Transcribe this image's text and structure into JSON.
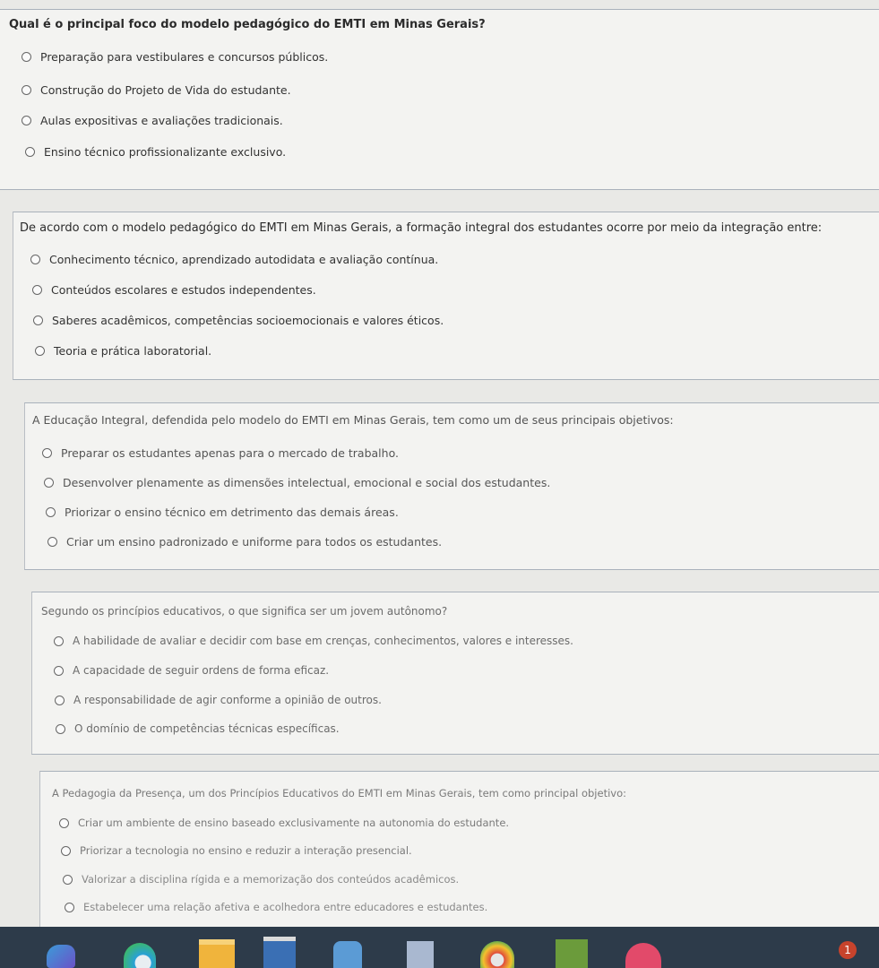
{
  "questions": [
    {
      "text": "Qual é o principal foco do modelo pedagógico do EMTI em Minas Gerais?",
      "options": [
        "Preparação para vestibulares e concursos públicos.",
        "Construção do Projeto de Vida do estudante.",
        "Aulas expositivas e avaliações tradicionais.",
        "Ensino técnico profissionalizante exclusivo."
      ]
    },
    {
      "text": "De acordo com o modelo pedagógico do EMTI em Minas Gerais, a formação integral dos estudantes ocorre por meio da integração entre:",
      "options": [
        "Conhecimento técnico, aprendizado autodidata e avaliação contínua.",
        "Conteúdos escolares e estudos independentes.",
        "Saberes acadêmicos, competências socioemocionais e valores éticos.",
        "Teoria e prática laboratorial."
      ]
    },
    {
      "text": "A Educação Integral, defendida pelo modelo do EMTI em Minas Gerais, tem como um de seus principais objetivos:",
      "options": [
        "Preparar os estudantes apenas para o mercado de trabalho.",
        "Desenvolver plenamente as dimensões intelectual, emocional e social dos estudantes.",
        "Priorizar o ensino técnico em detrimento das demais áreas.",
        "Criar um ensino padronizado e uniforme para todos os estudantes."
      ]
    },
    {
      "text": "Segundo os princípios educativos, o que significa ser um jovem autônomo?",
      "options": [
        "A habilidade de avaliar e decidir com base em crenças, conhecimentos, valores e interesses.",
        "A capacidade de seguir ordens de forma eficaz.",
        "A responsabilidade de agir conforme a opinião de outros.",
        "O domínio de competências técnicas específicas."
      ]
    },
    {
      "text": "A Pedagogia da Presença, um dos Princípios Educativos do EMTI em Minas Gerais, tem como principal objetivo:",
      "options": [
        "Criar um ambiente de ensino baseado exclusivamente na autonomia do estudante.",
        "Priorizar a tecnologia no ensino e reduzir a interação presencial.",
        "Valorizar a disciplina rígida e a memorização dos conteúdos acadêmicos.",
        "Estabelecer uma relação afetiva e acolhedora entre educadores e estudantes."
      ]
    }
  ],
  "taskbar": {
    "icons": [
      "copilot-icon",
      "edge-icon",
      "file-explorer-icon",
      "store-icon",
      "office-icon",
      "word-icon",
      "chrome-icon",
      "minecraft-icon",
      "cloud-icon"
    ],
    "notification_count": "1"
  }
}
